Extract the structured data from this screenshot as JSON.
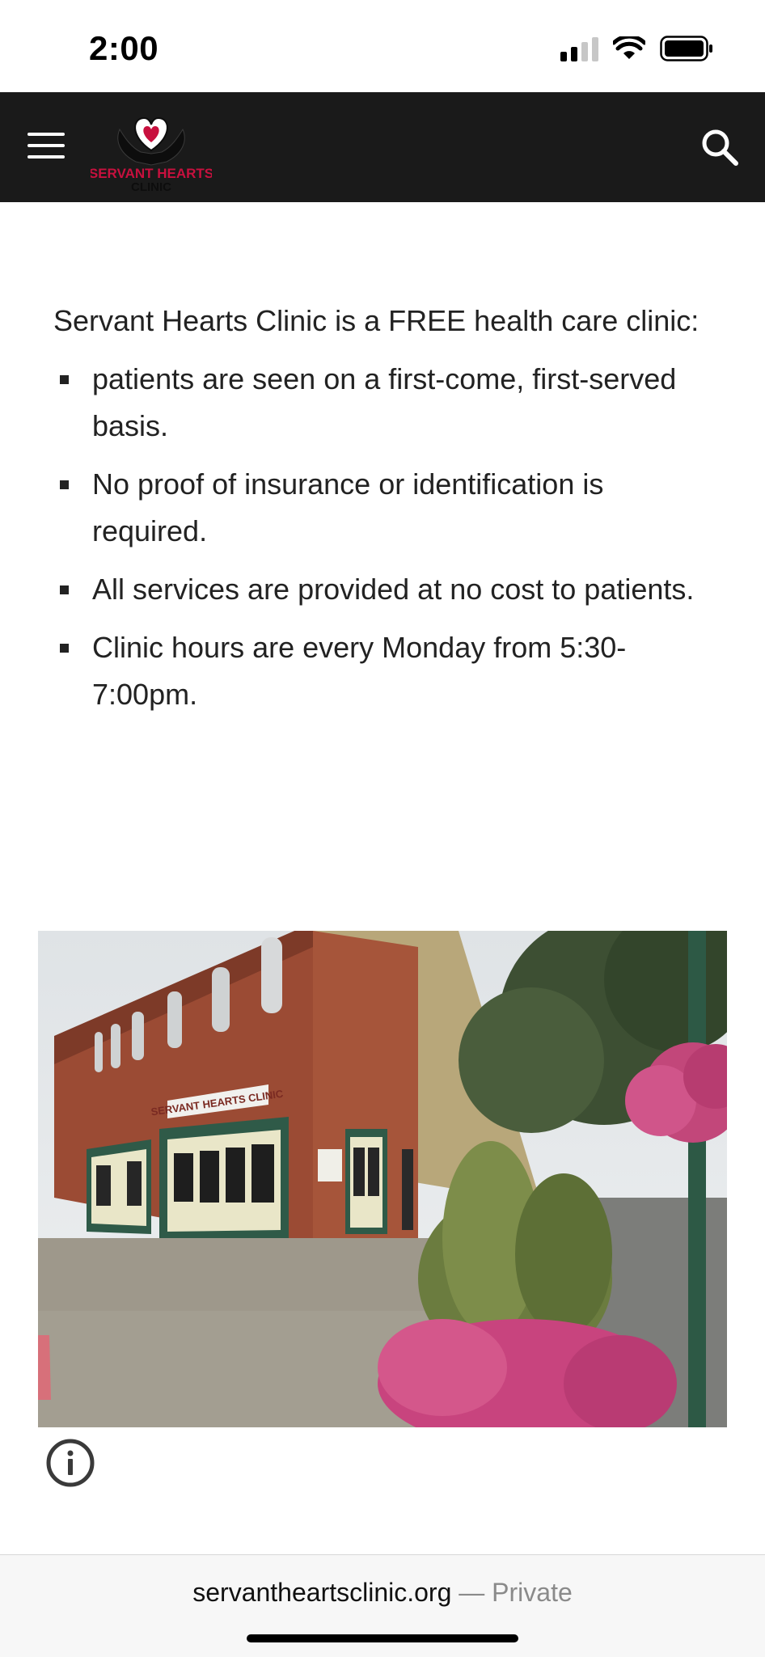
{
  "status_bar": {
    "time": "2:00",
    "signal_icon": "cellular-signal-icon",
    "wifi_icon": "wifi-icon",
    "battery_icon": "battery-icon"
  },
  "nav": {
    "menu_icon": "hamburger-menu-icon",
    "logo": {
      "line1": "SERVANT HEARTS",
      "line2": "CLINIC",
      "icon": "heart-hands-icon"
    },
    "search_icon": "search-icon"
  },
  "content": {
    "intro": "Servant Hearts Clinic is a FREE health care clinic:",
    "bullets": [
      "patients are seen on a first-come, first-served basis.",
      "No proof of insurance or identification is required.",
      "All services are provided at no cost to patients.",
      "Clinic hours are every Monday from 5:30-7:00pm."
    ]
  },
  "photo": {
    "sign_text": "SERVANT HEARTS CLINIC"
  },
  "info_icon": "info-icon",
  "address_bar": {
    "domain": "servantheartsclinic.org",
    "separator": " — ",
    "mode": "Private"
  },
  "colors": {
    "nav_background": "#1a1a1a",
    "brand_red": "#c8103e",
    "text": "#222222"
  }
}
